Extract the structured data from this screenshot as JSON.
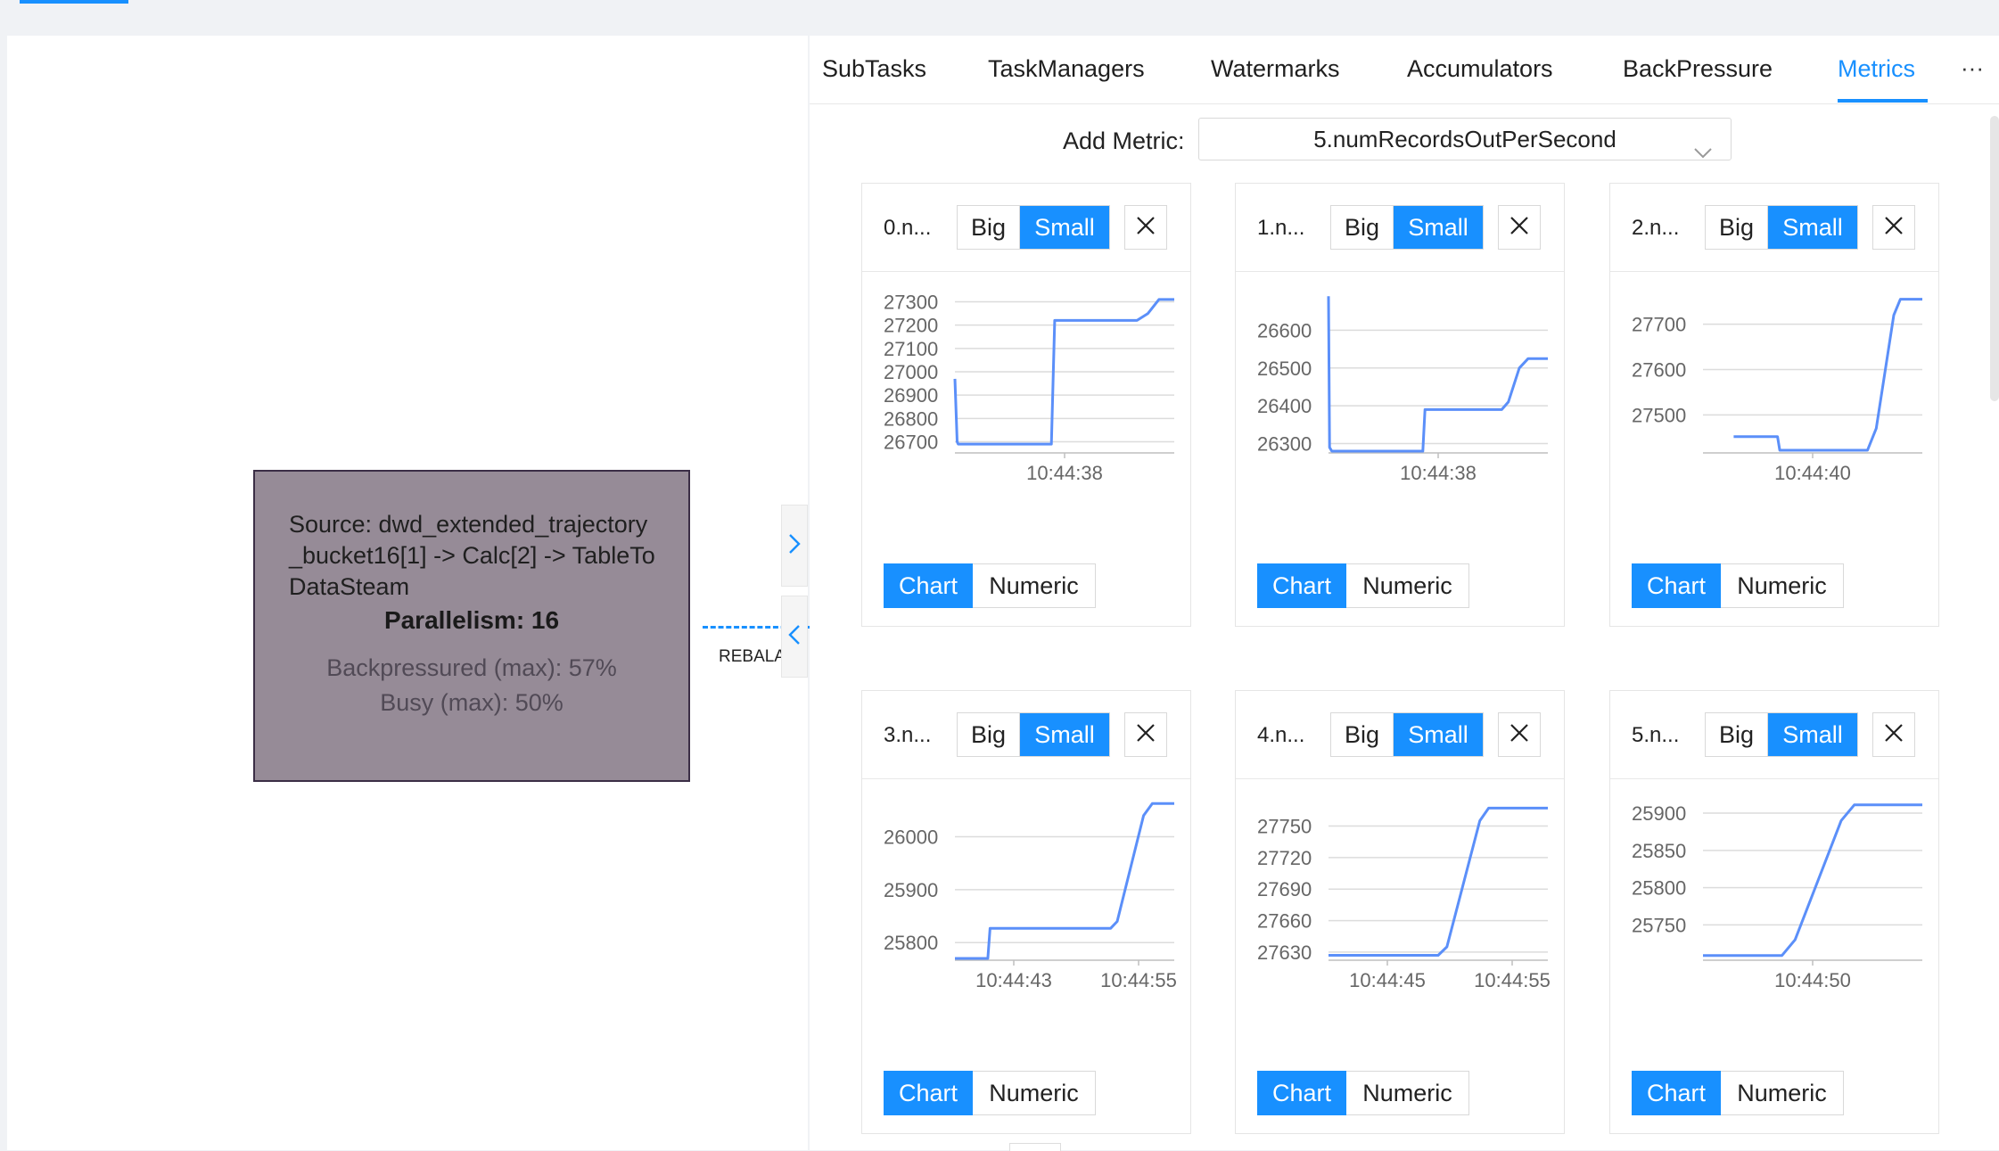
{
  "graph": {
    "node": {
      "name": "Source: dwd_extended_trajectory_bucket16[1] -> Calc[2] -> TableToDataSteam",
      "parallelism": "Parallelism: 16",
      "backpressured": "Backpressured (max): 57%",
      "busy": "Busy (max): 50%"
    },
    "edge_label": "REBALA"
  },
  "tabs": [
    {
      "label": "SubTasks",
      "active": false
    },
    {
      "label": "TaskManagers",
      "active": false
    },
    {
      "label": "Watermarks",
      "active": false
    },
    {
      "label": "Accumulators",
      "active": false
    },
    {
      "label": "BackPressure",
      "active": false
    },
    {
      "label": "Metrics",
      "active": true
    }
  ],
  "more_label": "···",
  "add_metric": {
    "label": "Add Metric:",
    "selected": "5.numRecordsOutPerSecond"
  },
  "colors": {
    "accent": "#1890ff",
    "line": "#5b8ff9",
    "node_fill": "#968b97",
    "node_border": "#3b2e46"
  },
  "cards": [
    {
      "title": "0.n...",
      "size_big": "Big",
      "size_small": "Small",
      "size_active": "Small",
      "close": "X",
      "view_chart": "Chart",
      "view_numeric": "Numeric",
      "view_active": "Chart",
      "chart_data": {
        "type": "line",
        "ylim": [
          26660,
          27340
        ],
        "yticks": [
          26700,
          26800,
          26900,
          27000,
          27100,
          27200,
          27300
        ],
        "xticks": [
          "10:44:38"
        ],
        "x": [
          0,
          1,
          1.5,
          44,
          45.5,
          83,
          88,
          93,
          100
        ],
        "values": [
          26970,
          26700,
          26690,
          26690,
          27220,
          27220,
          27250,
          27310,
          27310
        ]
      }
    },
    {
      "title": "1.n...",
      "size_big": "Big",
      "size_small": "Small",
      "size_active": "Small",
      "close": "X",
      "view_chart": "Chart",
      "view_numeric": "Numeric",
      "view_active": "Chart",
      "chart_data": {
        "type": "line",
        "ylim": [
          26280,
          26700
        ],
        "yticks": [
          26300,
          26400,
          26500,
          26600
        ],
        "xticks": [
          "10:44:38"
        ],
        "x": [
          0,
          0.5,
          1.5,
          43,
          44,
          79,
          82,
          87,
          91,
          100
        ],
        "values": [
          26690,
          26290,
          26280,
          26280,
          26390,
          26390,
          26410,
          26500,
          26525,
          26525
        ]
      }
    },
    {
      "title": "2.n...",
      "size_big": "Big",
      "size_small": "Small",
      "size_active": "Small",
      "close": "X",
      "view_chart": "Chart",
      "view_numeric": "Numeric",
      "view_active": "Chart",
      "chart_data": {
        "type": "line",
        "ylim": [
          27420,
          27770
        ],
        "yticks": [
          27500,
          27600,
          27700
        ],
        "xticks": [
          "10:44:40"
        ],
        "x": [
          14,
          34,
          35,
          75,
          79,
          87,
          90,
          100
        ],
        "values": [
          27452,
          27452,
          27422,
          27422,
          27470,
          27720,
          27755,
          27755
        ]
      }
    },
    {
      "title": "3.n...",
      "size_big": "Big",
      "size_small": "Small",
      "size_active": "Small",
      "close": "X",
      "view_chart": "Chart",
      "view_numeric": "Numeric",
      "view_active": "Chart",
      "chart_data": {
        "type": "line",
        "ylim": [
          25770,
          26070
        ],
        "yticks": [
          25800,
          25900,
          26000
        ],
        "xticks": [
          "10:44:43",
          "10:44:55"
        ],
        "x": [
          0,
          15,
          16,
          71,
          74,
          86,
          90,
          100
        ],
        "values": [
          25770,
          25770,
          25827,
          25827,
          25840,
          26040,
          26063,
          26063
        ]
      }
    },
    {
      "title": "4.n...",
      "size_big": "Big",
      "size_small": "Small",
      "size_active": "Small",
      "close": "X",
      "view_chart": "Chart",
      "view_numeric": "Numeric",
      "view_active": "Chart",
      "chart_data": {
        "type": "line",
        "ylim": [
          27624,
          27775
        ],
        "yticks": [
          27630,
          27660,
          27690,
          27720,
          27750
        ],
        "xticks": [
          "10:44:45",
          "10:44:55"
        ],
        "x": [
          0,
          50,
          54,
          69,
          73,
          100
        ],
        "values": [
          27627,
          27627,
          27635,
          27755,
          27767,
          27767
        ]
      }
    },
    {
      "title": "5.n...",
      "size_big": "Big",
      "size_small": "Small",
      "size_active": "Small",
      "close": "X",
      "view_chart": "Chart",
      "view_numeric": "Numeric",
      "view_active": "Chart",
      "chart_data": {
        "type": "line",
        "ylim": [
          25705,
          25918
        ],
        "yticks": [
          25750,
          25800,
          25850,
          25900
        ],
        "xticks": [
          "10:44:50"
        ],
        "x": [
          0,
          36,
          42,
          63,
          69,
          100
        ],
        "values": [
          25709,
          25709,
          25730,
          25890,
          25911,
          25911
        ]
      }
    }
  ]
}
